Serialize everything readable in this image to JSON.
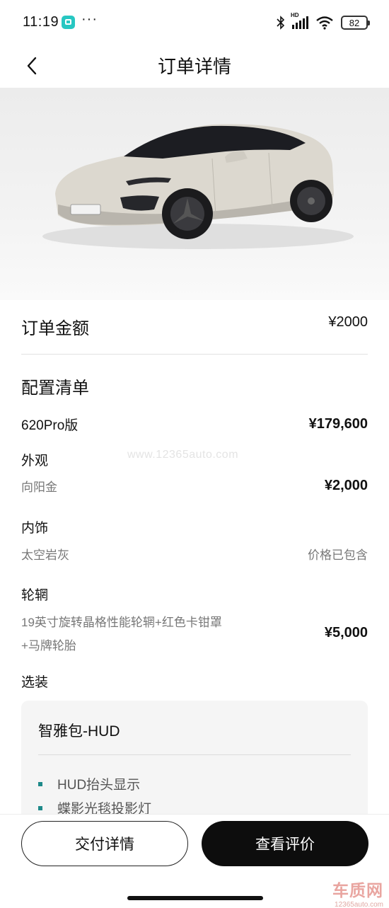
{
  "status_bar": {
    "time": "11:19",
    "more": "···",
    "hd": "HD",
    "battery": "82"
  },
  "header": {
    "title": "订单详情"
  },
  "order": {
    "amount_label": "订单金额",
    "amount_value": "¥2000"
  },
  "config": {
    "title": "配置清单",
    "model_name": "620Pro版",
    "model_price": "¥179,600",
    "exterior_label": "外观",
    "exterior_value": "向阳金",
    "exterior_price": "¥2,000",
    "interior_label": "内饰",
    "interior_value": "太空岩灰",
    "interior_price": "价格已包含",
    "wheel_label": "轮辋",
    "wheel_value_line1": "19英寸旋转晶格性能轮辋+红色卡钳罩",
    "wheel_value_line2": "+马牌轮胎",
    "wheel_price": "¥5,000",
    "options_label": "选装"
  },
  "option_pack": {
    "title": "智雅包-HUD",
    "features": [
      "HUD抬头显示",
      "蝶影光毯投影灯"
    ]
  },
  "watermark": "www.12365auto.com",
  "actions": {
    "delivery_label": "交付详情",
    "review_label": "查看评价"
  },
  "logo": {
    "main": "车质网",
    "sub": "12365auto.com"
  },
  "colors": {
    "accent_dot": "#1e8a8a",
    "primary_button": "#0d0d0d",
    "car_body": "#dcd8cf"
  }
}
